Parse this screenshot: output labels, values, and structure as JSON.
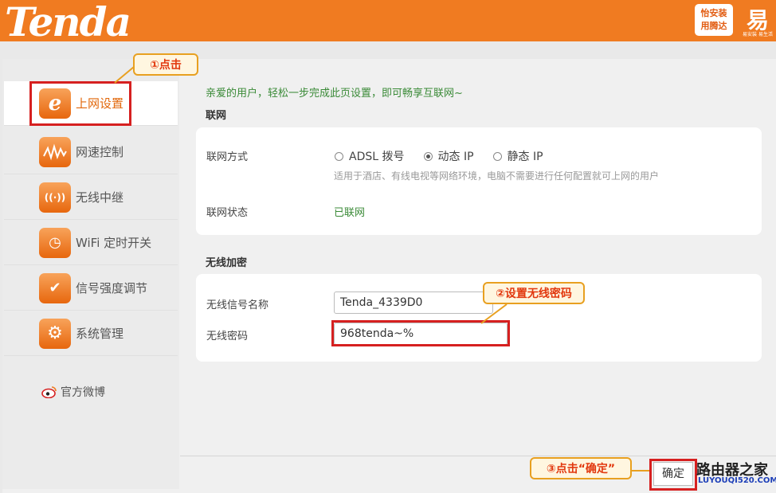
{
  "header": {
    "logo": "Tenda",
    "badge_line1": "怡安装",
    "badge_line2": "用腾达",
    "badge2_glyph": "易",
    "badge2_sub": "易安装 易生活"
  },
  "sidebar": {
    "items": [
      {
        "label": "上网设置",
        "icon": "ie-icon",
        "glyph": "e"
      },
      {
        "label": "网速控制",
        "icon": "speed-wave-icon",
        "glyph": "∿"
      },
      {
        "label": "无线中继",
        "icon": "wireless-repeater-icon",
        "glyph": "((·))"
      },
      {
        "label": "WiFi 定时开关",
        "icon": "timer-icon",
        "glyph": "◷"
      },
      {
        "label": "信号强度调节",
        "icon": "signal-check-icon",
        "glyph": "✔"
      },
      {
        "label": "系统管理",
        "icon": "gear-icon",
        "glyph": "⚙"
      }
    ],
    "weibo": "官方微博"
  },
  "annotations": {
    "step1": "①点击",
    "step2": "②设置无线密码",
    "step3": "③点击“确定”"
  },
  "main": {
    "intro": "亲爱的用户，轻松一步完成此页设置，即可畅享互联网~",
    "net_section": "联网",
    "conn_type_label": "联网方式",
    "conn_options": [
      "ADSL 拨号",
      "动态 IP",
      "静态 IP"
    ],
    "conn_selected": "动态 IP",
    "conn_hint": "适用于酒店、有线电视等网络环境，电脑不需要进行任何配置就可上网的用户",
    "conn_status_label": "联网状态",
    "conn_status": "已联网",
    "wifi_section": "无线加密",
    "ssid_label": "无线信号名称",
    "ssid_value": "Tenda_4339D0",
    "password_label": "无线密码",
    "password_value": "968tenda~%"
  },
  "footer": {
    "ok_label": "确定",
    "watermark": "路由器之家",
    "watermark_url": "LUYOUQI520.COM"
  },
  "colors": {
    "brand_orange": "#f07b21",
    "highlight_red": "#d62020",
    "status_green": "#3a8a37"
  }
}
